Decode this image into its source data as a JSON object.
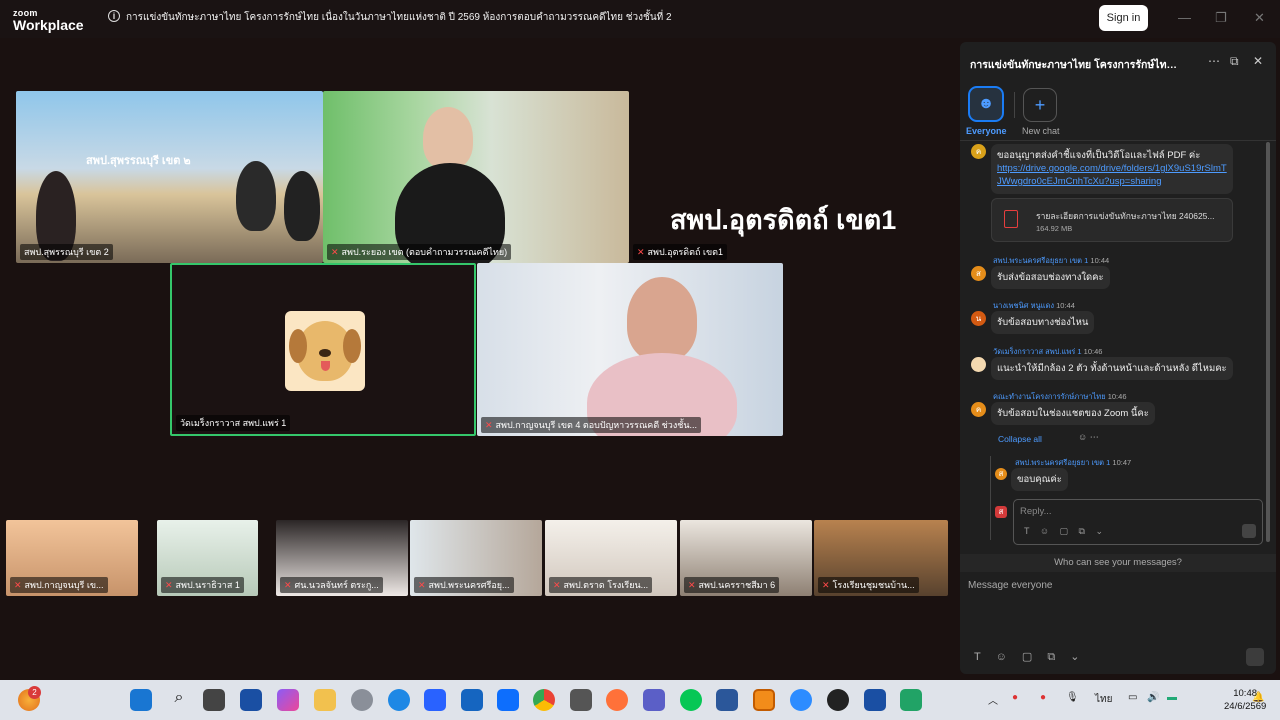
{
  "app": {
    "brand_top": "zoom",
    "brand_bottom": "Workplace",
    "window_title": "การแข่งขันทักษะภาษาไทย โครงการรักษ์ไทย เนื่องในวันภาษาไทยแห่งชาติ ปี 2569  ห้องการตอบคำถามวรรณคดีไทย ช่วงชั้นที่ 2",
    "sign_in": "Sign in"
  },
  "stage": {
    "big_name": "สพป.อุตรดิตถ์ เขต1",
    "tiles": [
      {
        "label": "สพป.สุพรรณบุรี เขต 2",
        "sign": "สพป.สุพรรณบุรี เขต ๒"
      },
      {
        "label": "สพป.ระยอง เขต (ตอบคำถามวรรณคดีไทย)"
      },
      {
        "label": "สพป.อุตรดิตถ์ เขต1"
      },
      {
        "label": "วัดเมร็งกราวาส สพป.แพร่ 1"
      },
      {
        "label": "สพป.กาญจนบุรี เขต 4 ตอบปัญหาวรรณคดี ช่วงชั้น..."
      }
    ],
    "strip": [
      "สพป.กาญจนบุรี เข...",
      "สพป.นราธิวาส 1",
      "ศน.นวลจันทร์ ตระกู...",
      "สพป.พระนครศรีอยุ...",
      "สพป.ตราด โรงเรียน...",
      "สพป.นครราชสีมา 6",
      "โรงเรียนชุมชนบ้าน..."
    ]
  },
  "chat": {
    "title": "การแข่งขันทักษะภาษาไทย โครงการรักษ์ไทย เนื่อ...",
    "tab_everyone": "Everyone",
    "tab_new": "New chat",
    "m1_text": "ขออนุญาตส่งคำชี้แจงที่เป็นวิดีโอและไฟล์ PDF ค่ะ",
    "m1_link": "https://drive.google.com/drive/folders/1glX9uS19rSlmTJWwgdro0cEJmCnhTcXu?usp=sharing",
    "file_name": "รายละเอียดการแข่งขันทักษะภาษาไทย 240625...",
    "file_size": "164.92 MB",
    "m2_sender": "สพป.พระนครศรีอยุธยา เขต 1",
    "m2_time": "10:44",
    "m2_text": "รับส่งข้อสอบช่องทางใดคะ",
    "m3_sender": "นางเพชนิศ หนูแดง",
    "m3_time": "10:44",
    "m3_text": "รับข้อสอบทางช่องไหน",
    "m4_sender": "วัดเมร็งกราวาส สพป.แพร่ 1",
    "m4_time": "10:46",
    "m4_text": "แนะนำให้มีกล้อง 2 ตัว ทั้งด้านหน้าและด้านหลัง ดีไหมคะ",
    "m5_sender": "คณะทำงานโครงการรักษ์ภาษาไทย",
    "m5_time": "10:46",
    "m5_text": "รับข้อสอบในช่องแชตของ Zoom นี้คะ",
    "collapse": "Collapse all",
    "r_sender": "สพป.พระนครศรีอยุธยา เขต 1",
    "r_time": "10:47",
    "r_text": "ขอบคุณค่ะ",
    "reply_placeholder": "Reply...",
    "who_can_see": "Who can see your messages?",
    "message_placeholder": "Message everyone"
  },
  "taskbar": {
    "badge": "2",
    "lang": "ไทย",
    "time": "10:48",
    "date": "24/6/2569"
  }
}
